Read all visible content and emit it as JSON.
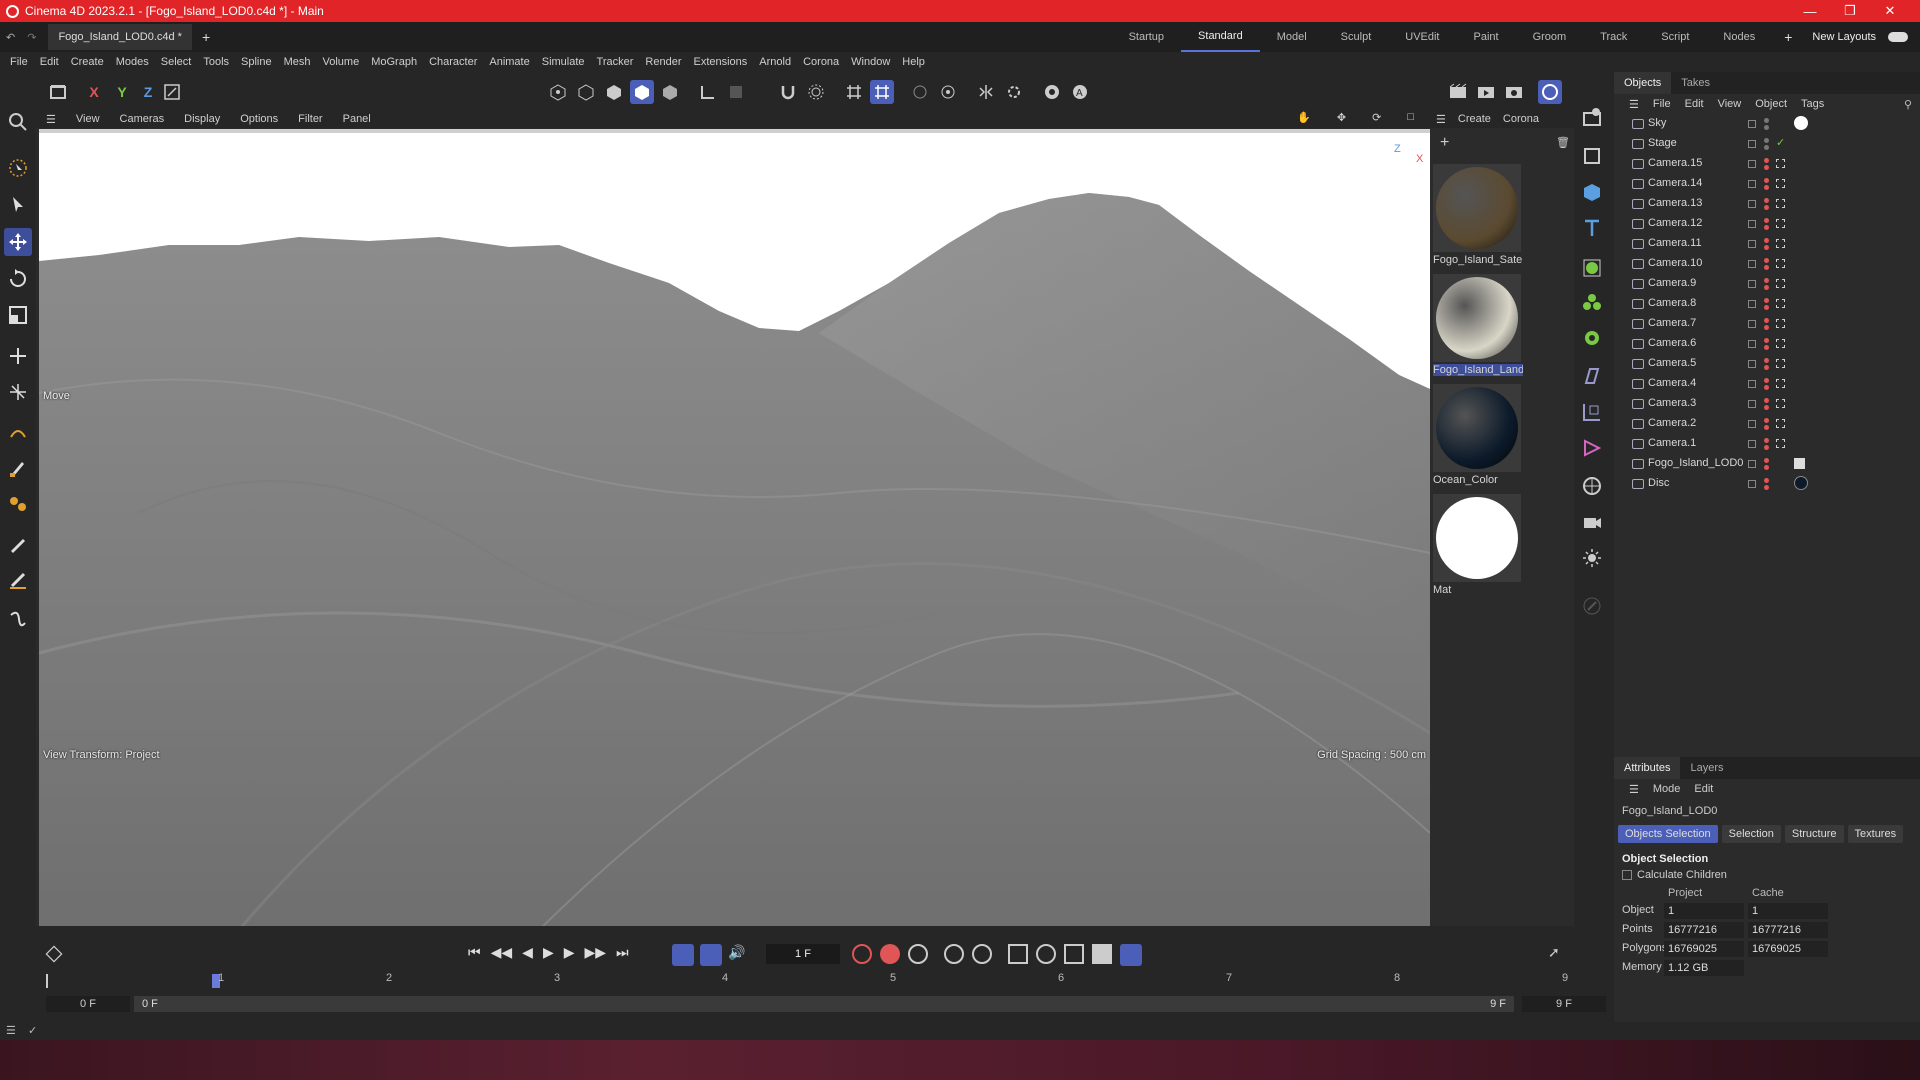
{
  "window": {
    "title": "Cinema 4D 2023.2.1 - [Fogo_Island_LOD0.c4d *] - Main"
  },
  "doc_tab": "Fogo_Island_LOD0.c4d *",
  "layouts": [
    {
      "label": "Startup",
      "active": false
    },
    {
      "label": "Standard",
      "active": true
    },
    {
      "label": "Model",
      "active": false
    },
    {
      "label": "Sculpt",
      "active": false
    },
    {
      "label": "UVEdit",
      "active": false
    },
    {
      "label": "Paint",
      "active": false
    },
    {
      "label": "Groom",
      "active": false
    },
    {
      "label": "Track",
      "active": false
    },
    {
      "label": "Script",
      "active": false
    },
    {
      "label": "Nodes",
      "active": false
    }
  ],
  "new_layouts": "New Layouts",
  "menu": [
    "File",
    "Edit",
    "Create",
    "Modes",
    "Select",
    "Tools",
    "Spline",
    "Mesh",
    "Volume",
    "MoGraph",
    "Character",
    "Animate",
    "Simulate",
    "Tracker",
    "Render",
    "Extensions",
    "Arnold",
    "Corona",
    "Window",
    "Help"
  ],
  "axes": {
    "x": "X",
    "y": "Y",
    "z": "Z"
  },
  "view_menu": [
    "View",
    "Cameras",
    "Display",
    "Options",
    "Filter",
    "Panel"
  ],
  "viewport": {
    "tool_label": "Move",
    "view_transform": "View Transform: Project",
    "grid_spacing": "Grid Spacing : 500 cm",
    "axis_z": "Z",
    "axis_x": "X"
  },
  "mat_menu": [
    "Create",
    "Corona"
  ],
  "materials": [
    {
      "name": "Fogo_Island_Satel",
      "color": "#5b4a30"
    },
    {
      "name": "Fogo_Island_Land",
      "color": "#d9d6c8"
    },
    {
      "name": "Ocean_Color",
      "color": "#0c1a2a"
    },
    {
      "name": "Mat",
      "color": "#ffffff"
    }
  ],
  "objects_tabs": [
    "Objects",
    "Takes"
  ],
  "objects_menu": [
    "File",
    "Edit",
    "View",
    "Object",
    "Tags"
  ],
  "objects": [
    "Sky",
    "Stage",
    "Camera.15",
    "Camera.14",
    "Camera.13",
    "Camera.12",
    "Camera.11",
    "Camera.10",
    "Camera.9",
    "Camera.8",
    "Camera.7",
    "Camera.6",
    "Camera.5",
    "Camera.4",
    "Camera.3",
    "Camera.2",
    "Camera.1",
    "Fogo_Island_LOD0",
    "Disc"
  ],
  "attr_tabs": [
    "Attributes",
    "Layers"
  ],
  "attr_menu": [
    "Mode",
    "Edit"
  ],
  "attr": {
    "object_name": "Fogo_Island_LOD0",
    "sub_tabs": [
      "Objects Selection",
      "Selection",
      "Structure",
      "Textures"
    ],
    "section": "Object Selection",
    "calc_children": "Calculate Children",
    "col_project": "Project",
    "col_cache": "Cache",
    "rows": [
      {
        "label": "Object",
        "project": "1",
        "cache": "1"
      },
      {
        "label": "Points",
        "project": "16777216",
        "cache": "16777216"
      },
      {
        "label": "Polygons",
        "project": "16769025",
        "cache": "16769025"
      },
      {
        "label": "Memory",
        "project": "1.12 GB",
        "cache": ""
      }
    ]
  },
  "timeline": {
    "frame_field": "1 F",
    "ticks": [
      "1",
      "2",
      "3",
      "4",
      "5",
      "6",
      "7",
      "8",
      "9"
    ],
    "start": "0 F",
    "start2": "0 F",
    "end": "9 F",
    "end2": "9 F"
  }
}
